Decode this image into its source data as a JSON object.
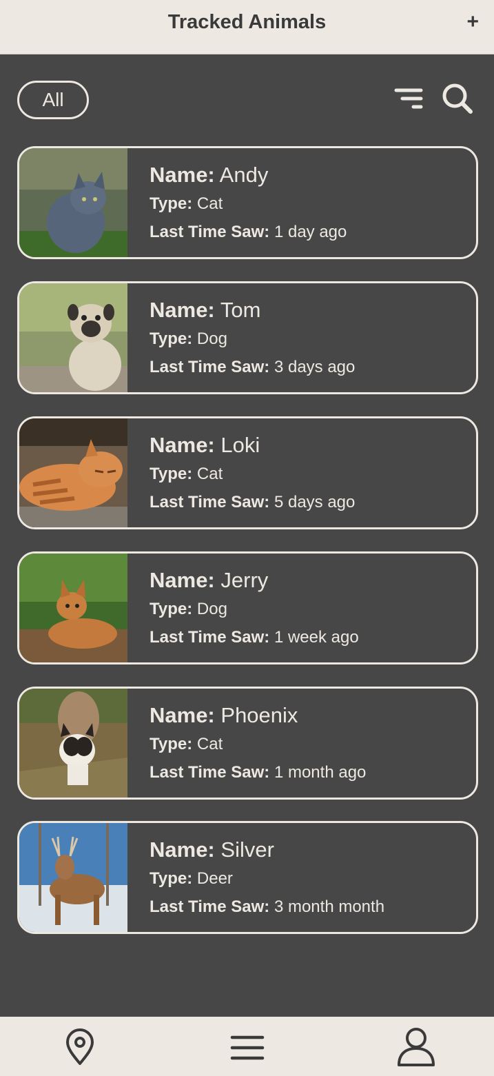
{
  "header": {
    "title": "Tracked Animals",
    "add_label": "+"
  },
  "toolbar": {
    "filter_pill": "All",
    "sort_icon": "filter-lines-icon",
    "search_icon": "search-icon"
  },
  "labels": {
    "name": "Name:",
    "type": "Type:",
    "last_seen": "Last Time Saw:"
  },
  "animals": [
    {
      "name": "Andy",
      "type": "Cat",
      "last_seen": "1 day ago",
      "photo": "cat-photo"
    },
    {
      "name": "Tom",
      "type": "Dog",
      "last_seen": "3 days ago",
      "photo": "dog-photo"
    },
    {
      "name": "Loki",
      "type": "Cat",
      "last_seen": "5 days ago",
      "photo": "cat-photo"
    },
    {
      "name": "Jerry",
      "type": "Dog",
      "last_seen": "1 week ago",
      "photo": "dog-photo"
    },
    {
      "name": "Phoenix",
      "type": "Cat",
      "last_seen": "1 month ago",
      "photo": "cat-photo"
    },
    {
      "name": "Silver",
      "type": "Deer",
      "last_seen": "3 month month",
      "photo": "deer-photo"
    }
  ],
  "bottom_nav": [
    {
      "icon": "map-pin-icon"
    },
    {
      "icon": "menu-icon"
    },
    {
      "icon": "user-icon"
    }
  ],
  "colors": {
    "background": "#474747",
    "header_bg": "#ede8e1",
    "accent_text": "#ede8e1",
    "title_text": "#3a3a3a"
  }
}
